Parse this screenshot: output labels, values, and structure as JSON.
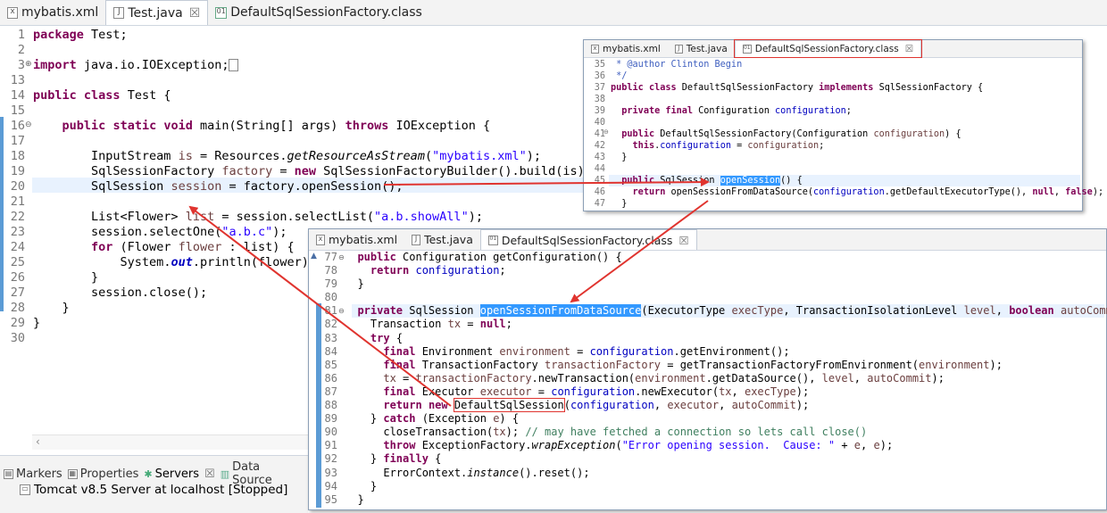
{
  "main_editor": {
    "tabs": [
      {
        "label": "mybatis.xml",
        "icon": "xml-file-icon"
      },
      {
        "label": "Test.java",
        "icon": "java-file-icon",
        "close": "☒"
      },
      {
        "label": "DefaultSqlSessionFactory.class",
        "icon": "class-file-icon"
      }
    ],
    "line_numbers": [
      "1",
      "2",
      "3",
      "13",
      "14",
      "15",
      "16",
      "17",
      "18",
      "19",
      "20",
      "21",
      "22",
      "23",
      "24",
      "25",
      "26",
      "27",
      "28",
      "29",
      "30"
    ],
    "code": {
      "l1_kw": "package",
      "l1_rest": " Test;",
      "l3_kw": "import",
      "l3_rest": " java.io.IOException;",
      "l14_kw1": "public",
      "l14_kw2": "class",
      "l14_rest": " Test {",
      "l16_kw1": "public",
      "l16_kw2": "static",
      "l16_kw3": "void",
      "l16_mid": " main(String[] args) ",
      "l16_kw4": "throws",
      "l16_rest": " IOException {",
      "l18_a": "InputStream ",
      "l18_var": "is",
      "l18_b": " = Resources.",
      "l18_m": "getResourceAsStream",
      "l18_c": "(",
      "l18_s": "\"mybatis.xml\"",
      "l18_d": ");",
      "l19_a": "SqlSessionFactory ",
      "l19_var": "factory",
      "l19_b": " = ",
      "l19_kw": "new",
      "l19_c": " SqlSessionFactoryBuilder().build(is);",
      "l20_a": "SqlSession ",
      "l20_var": "session",
      "l20_b": " = factory.openSession();",
      "l22_a": "List<Flower> ",
      "l22_var": "list",
      "l22_b": " = session.selectList(",
      "l22_s": "\"a.b.showAll\"",
      "l22_c": ");",
      "l23_a": "session.selectOne(",
      "l23_s": "\"a.b.c\"",
      "l23_b": ");",
      "l24_kw": "for",
      "l24_a": " (Flower ",
      "l24_var": "flower",
      "l24_b": " : list) {",
      "l25_a": "System.",
      "l25_f": "out",
      "l25_b": ".println(flower);",
      "l26": "}",
      "l27": "session.close();",
      "l28": "}",
      "l29": "}"
    }
  },
  "bottom_panel": {
    "tabs": [
      {
        "label": "Markers",
        "icon": "markers-icon"
      },
      {
        "label": "Properties",
        "icon": "properties-icon"
      },
      {
        "label": "Servers",
        "icon": "servers-icon",
        "close": "☒"
      },
      {
        "label": "Data Source",
        "icon": "data-source-icon"
      }
    ],
    "server_entry": "Tomcat v8.5 Server at localhost  [Stopped]"
  },
  "top_popup": {
    "tabs": [
      {
        "label": "mybatis.xml"
      },
      {
        "label": "Test.java"
      },
      {
        "label": "DefaultSqlSessionFactory.class",
        "close": "☒"
      }
    ],
    "line_numbers": [
      "35",
      "36",
      "37",
      "38",
      "39",
      "40",
      "41",
      "42",
      "43",
      "44",
      "45",
      "46",
      "47"
    ],
    "code": {
      "l35": " * @author Clinton Begin",
      "l36": " */",
      "l37_kw1": "public",
      "l37_kw2": "class",
      "l37_a": " DefaultSqlSessionFactory ",
      "l37_kw3": "implements",
      "l37_b": " SqlSessionFactory {",
      "l39_kw1": "private",
      "l39_kw2": "final",
      "l39_a": " Configuration ",
      "l39_f": "configuration",
      "l39_b": ";",
      "l41_kw": "public",
      "l41_a": " DefaultSqlSessionFactory(Configuration ",
      "l41_v": "configuration",
      "l41_b": ") {",
      "l42_kw": "this",
      "l42_a": ".",
      "l42_f": "configuration",
      "l42_b": " = ",
      "l42_v": "configuration",
      "l42_c": ";",
      "l43": "}",
      "l45_kw": "public",
      "l45_a": " SqlSession ",
      "l45_sel": "openSession",
      "l45_b": "() {",
      "l46_kw": "return",
      "l46_a": " openSessionFromDataSource(",
      "l46_f": "configuration",
      "l46_b": ".getDefaultExecutorType(), ",
      "l46_kw2": "null",
      "l46_c": ", ",
      "l46_kw3": "false",
      "l46_d": ");",
      "l47": "}"
    }
  },
  "bottom_popup": {
    "tabs": [
      {
        "label": "mybatis.xml"
      },
      {
        "label": "Test.java"
      },
      {
        "label": "DefaultSqlSessionFactory.class",
        "close": "☒"
      }
    ],
    "line_numbers": [
      "77",
      "78",
      "79",
      "80",
      "81",
      "82",
      "83",
      "84",
      "85",
      "86",
      "87",
      "88",
      "89",
      "90",
      "91",
      "92",
      "93",
      "94",
      "95"
    ],
    "code": {
      "l77_kw": "public",
      "l77_a": " Configuration getConfiguration() {",
      "l78_kw": "return",
      "l78_f": "configuration",
      "l78_b": ";",
      "l79": "}",
      "l81_kw": "private",
      "l81_a": " SqlSession ",
      "l81_sel": "openSessionFromDataSource",
      "l81_b": "(ExecutorType ",
      "l81_v1": "execType",
      "l81_c": ", TransactionIsolationLevel ",
      "l81_v2": "level",
      "l81_d": ", ",
      "l81_kw2": "boolean",
      "l81_v3": "autoCommit",
      "l81_e": ") {",
      "l82_a": "Transaction ",
      "l82_v": "tx",
      "l82_b": " = ",
      "l82_kw": "null",
      "l82_c": ";",
      "l83_kw": "try",
      "l83_a": " {",
      "l84_kw": "final",
      "l84_a": " Environment ",
      "l84_v": "environment",
      "l84_b": " = ",
      "l84_f": "configuration",
      "l84_c": ".getEnvironment();",
      "l85_kw": "final",
      "l85_a": " TransactionFactory ",
      "l85_v": "transactionFactory",
      "l85_b": " = getTransactionFactoryFromEnvironment(",
      "l85_v2": "environment",
      "l85_c": ");",
      "l86_v": "tx",
      "l86_a": " = ",
      "l86_v2": "transactionFactory",
      "l86_b": ".newTransaction(",
      "l86_v3": "environment",
      "l86_c": ".getDataSource(), ",
      "l86_v4": "level",
      "l86_d": ", ",
      "l86_v5": "autoCommit",
      "l86_e": ");",
      "l87_kw": "final",
      "l87_a": " Executor ",
      "l87_v": "executor",
      "l87_b": " = ",
      "l87_f": "configuration",
      "l87_c": ".newExecutor(",
      "l87_v2": "tx",
      "l87_d": ", ",
      "l87_v3": "execType",
      "l87_e": ");",
      "l88_kw1": "return",
      "l88_kw2": "new",
      "l88_box": "DefaultSqlSession",
      "l88_a": "(",
      "l88_f": "configuration",
      "l88_b": ", ",
      "l88_v": "executor",
      "l88_c": ", ",
      "l88_v2": "autoCommit",
      "l88_d": ");",
      "l89_a": "} ",
      "l89_kw": "catch",
      "l89_b": " (Exception ",
      "l89_v": "e",
      "l89_c": ") {",
      "l90_a": "closeTransaction(",
      "l90_v": "tx",
      "l90_b": "); ",
      "l90_cm": "// may have fetched a connection so lets call close()",
      "l91_kw": "throw",
      "l91_a": " ExceptionFactory.",
      "l91_m": "wrapException",
      "l91_b": "(",
      "l91_s": "\"Error opening session.  Cause: \"",
      "l91_c": " + ",
      "l91_v": "e",
      "l91_d": ", ",
      "l91_v2": "e",
      "l91_e": ");",
      "l92_a": "} ",
      "l92_kw": "finally",
      "l92_b": " {",
      "l93_a": "ErrorContext.",
      "l93_m": "instance",
      "l93_b": "().reset();",
      "l94": "}",
      "l95": "}"
    }
  },
  "colors": {
    "arrow": "#e0342f",
    "selection": "#3399ff",
    "keyword": "#7f0055",
    "string": "#2a00ff",
    "field": "#0000c0"
  }
}
